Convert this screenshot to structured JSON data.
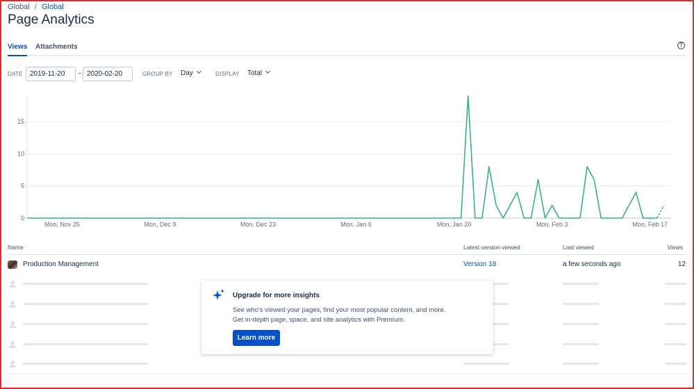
{
  "breadcrumb": {
    "items": [
      "Global",
      "Global"
    ],
    "separator": "/"
  },
  "page_title": "Page Analytics",
  "tabs": [
    {
      "label": "Views",
      "active": true
    },
    {
      "label": "Attachments",
      "active": false
    }
  ],
  "help_icon": "?",
  "filters": {
    "date_label": "DATE",
    "date_from": "2019-11-20",
    "date_to": "2020-02-20",
    "range_dash": "–",
    "group_by_label": "GROUP BY",
    "group_by_value": "Day",
    "display_label": "DISPLAY",
    "display_value": "Total"
  },
  "chart_data": {
    "type": "line",
    "x_tick_labels": [
      "Mon, Nov 25",
      "Mon, Dec 9",
      "Mon, Dec 23",
      "Mon, Jan 6",
      "Mon, Jan 20",
      "Mon, Feb 3",
      "Mon, Feb 17"
    ],
    "y_ticks": [
      0,
      5,
      10,
      15
    ],
    "ylim": [
      0,
      19
    ],
    "start_date": "2019-11-20",
    "end_date": "2020-02-20",
    "series_color": "#36b37e",
    "series": [
      {
        "name": "Views",
        "points": [
          [
            "2019-11-20",
            0
          ],
          [
            "2020-01-21",
            0
          ],
          [
            "2020-01-22",
            19
          ],
          [
            "2020-01-23",
            0
          ],
          [
            "2020-01-24",
            0
          ],
          [
            "2020-01-25",
            8
          ],
          [
            "2020-01-26",
            2
          ],
          [
            "2020-01-27",
            0
          ],
          [
            "2020-01-29",
            4
          ],
          [
            "2020-01-30",
            0
          ],
          [
            "2020-01-31",
            0
          ],
          [
            "2020-02-01",
            6
          ],
          [
            "2020-02-02",
            0
          ],
          [
            "2020-02-03",
            2
          ],
          [
            "2020-02-04",
            0
          ],
          [
            "2020-02-07",
            0
          ],
          [
            "2020-02-08",
            8
          ],
          [
            "2020-02-09",
            6
          ],
          [
            "2020-02-10",
            0
          ],
          [
            "2020-02-13",
            0
          ],
          [
            "2020-02-15",
            4
          ],
          [
            "2020-02-16",
            0
          ],
          [
            "2020-02-17",
            0
          ],
          [
            "2020-02-18",
            0
          ]
        ],
        "dashed_tail": [
          [
            "2020-02-18",
            0
          ],
          [
            "2020-02-19",
            2
          ]
        ]
      }
    ]
  },
  "table": {
    "headers": {
      "name": "Name",
      "latest_version": "Latest version viewed",
      "last_viewed": "Last viewed",
      "views": "Views"
    },
    "rows": [
      {
        "name": "Production Management",
        "latest_version": "Version 18",
        "last_viewed": "a few seconds ago",
        "views": "12"
      }
    ]
  },
  "upgrade": {
    "title": "Upgrade for more insights",
    "line1": "See who's viewed your pages, find your most popular content, and more.",
    "line2": "Get in-depth page, space, and site analytics with Premium.",
    "button": "Learn more"
  }
}
